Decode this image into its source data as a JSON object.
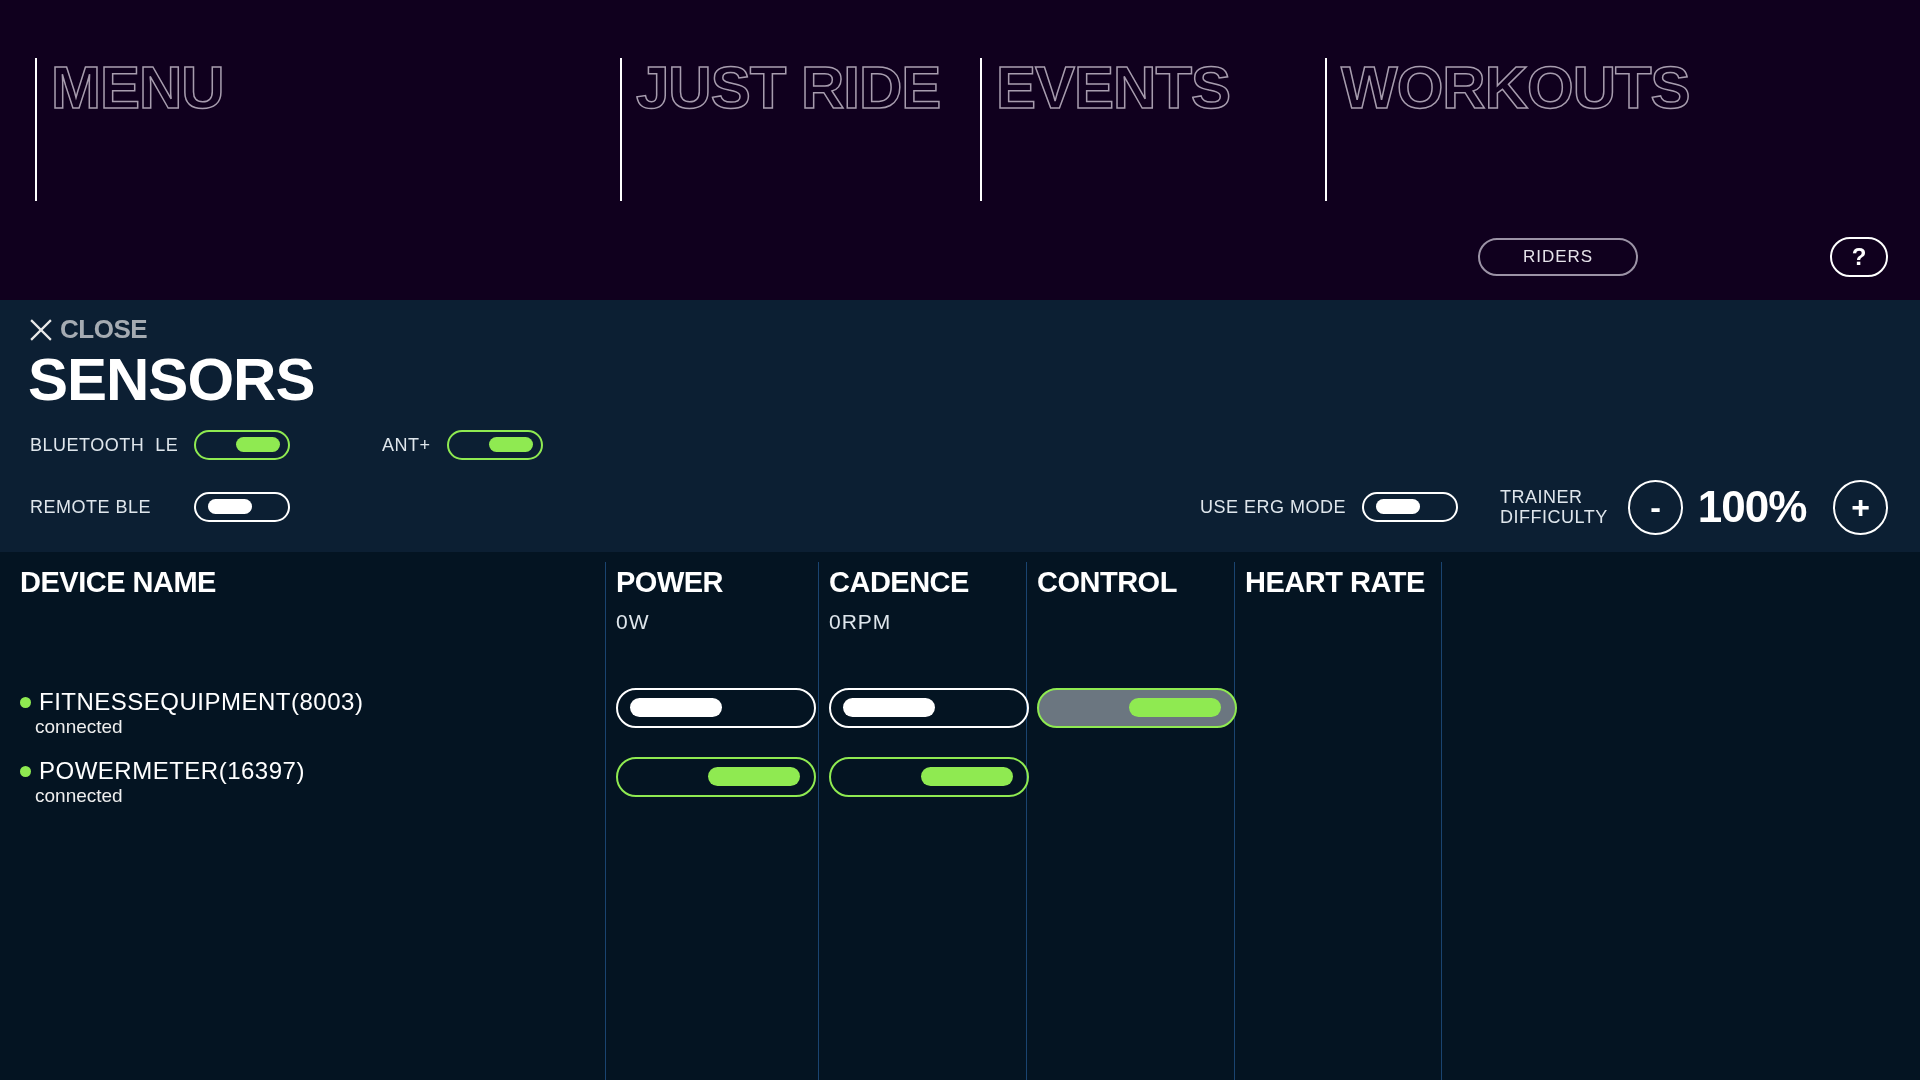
{
  "nav": [
    {
      "label": "MENU"
    },
    {
      "label": "JUST RIDE"
    },
    {
      "label": "EVENTS"
    },
    {
      "label": "WORKOUTS"
    }
  ],
  "riders_button": "RIDERS",
  "help_button": "?",
  "panel": {
    "close": "CLOSE",
    "title": "SENSORS",
    "toggles": [
      {
        "label": "BLUETOOTH  LE",
        "on": true
      },
      {
        "label": "ANT+",
        "on": true
      },
      {
        "label": "REMOTE BLE",
        "on": false
      },
      {
        "label": "USE ERG MODE",
        "on": false
      }
    ],
    "difficulty": {
      "label": "TRAINER DIFFICULTY",
      "minus": "-",
      "value": "100%",
      "plus": "+"
    }
  },
  "table": {
    "columns": [
      {
        "title": "DEVICE NAME"
      },
      {
        "title": "POWER",
        "reading": "0W"
      },
      {
        "title": "CADENCE",
        "reading": "0RPM"
      },
      {
        "title": "CONTROL"
      },
      {
        "title": "HEART RATE"
      }
    ],
    "rows": [
      {
        "name": "FITNESSEQUIPMENT(8003)",
        "status": "connected",
        "color": "#8fea51",
        "cells": [
          {
            "kind": "toggle",
            "on": false,
            "highlighted": false
          },
          {
            "kind": "toggle",
            "on": false,
            "highlighted": false
          },
          {
            "kind": "toggle",
            "on": true,
            "highlighted": true
          },
          {
            "kind": "empty"
          }
        ]
      },
      {
        "name": "POWERMETER(16397)",
        "status": "connected",
        "color": "#8fea51",
        "cells": [
          {
            "kind": "toggle",
            "on": true,
            "highlighted": false
          },
          {
            "kind": "toggle",
            "on": true,
            "highlighted": false
          },
          {
            "kind": "empty"
          },
          {
            "kind": "empty"
          }
        ]
      }
    ]
  }
}
